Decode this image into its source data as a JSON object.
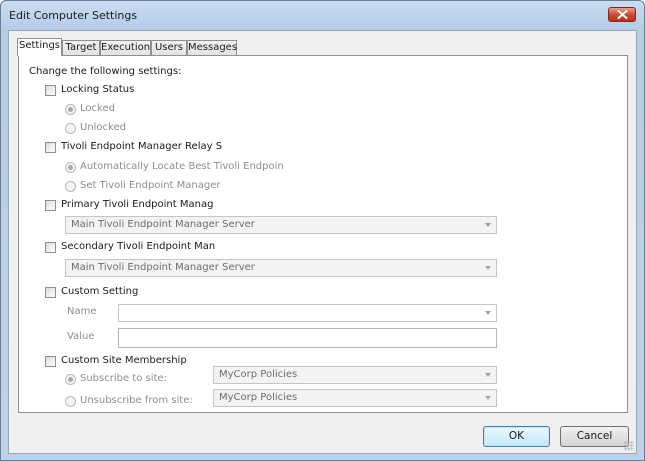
{
  "window": {
    "title": "Edit Computer Settings"
  },
  "tabs": [
    "Settings",
    "Target",
    "Execution",
    "Users",
    "Messages"
  ],
  "settings": {
    "intro": "Change the following settings:",
    "locking": {
      "label": "Locking Status",
      "options": [
        "Locked",
        "Unlocked"
      ]
    },
    "relay": {
      "label": "Tivoli Endpoint Manager Relay S",
      "options": [
        "Automatically Locate Best Tivoli Endpoin",
        "Set Tivoli Endpoint Manager"
      ]
    },
    "primary": {
      "label": "Primary Tivoli Endpoint Manag",
      "value": "Main Tivoli Endpoint Manager Server"
    },
    "secondary": {
      "label": "Secondary Tivoli Endpoint Man",
      "value": "Main Tivoli Endpoint Manager Server"
    },
    "custom": {
      "label": "Custom Setting",
      "name_label": "Name",
      "value_label": "Value",
      "name_value": "",
      "value_value": ""
    },
    "site": {
      "label": "Custom Site Membership",
      "subscribe_label": "Subscribe to site:",
      "subscribe_value": "MyCorp Policies",
      "unsubscribe_label": "Unsubscribe from site:",
      "unsubscribe_value": "MyCorp Policies"
    }
  },
  "buttons": {
    "ok": "OK",
    "cancel": "Cancel"
  }
}
